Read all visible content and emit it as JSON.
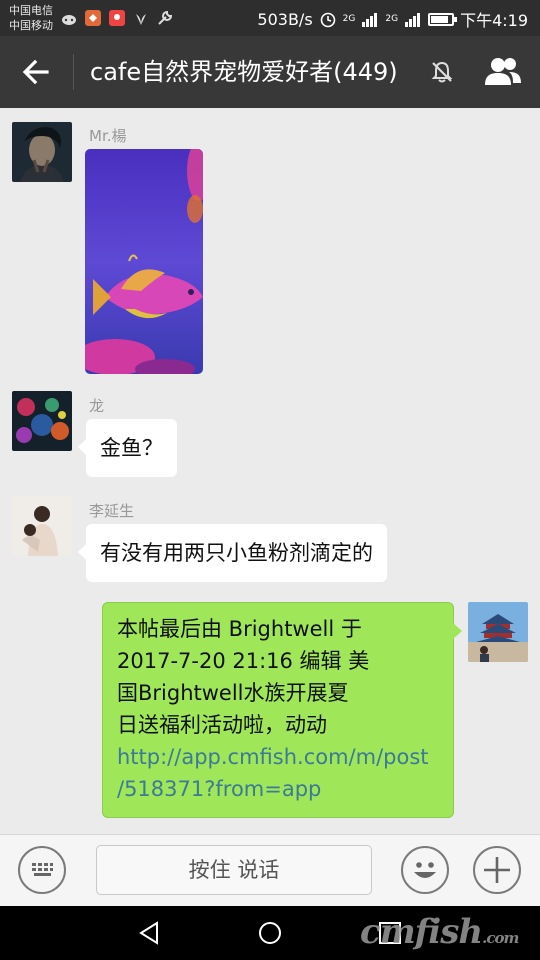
{
  "status_bar": {
    "carrier1": "中国电信",
    "carrier2": "中国移动",
    "speed": "503B/s",
    "network1": "2G",
    "network2": "2G",
    "time": "下午4:19",
    "battery_level": 0.75
  },
  "header": {
    "title": "cafe自然界宠物爱好者(449)"
  },
  "messages": [
    {
      "sender": "Mr.楊",
      "type": "image"
    },
    {
      "sender": "龙",
      "text": "金鱼？"
    },
    {
      "sender": "李延生",
      "text": "有没有用两只小鱼粉剂滴定的"
    },
    {
      "self": true,
      "line1": "本帖最后由 Brightwell 于",
      "line2": "2017-7-20 21:16 编辑 美",
      "line3": "国Brightwell水族开展夏",
      "line4": "日送福利活动啦，动动",
      "link_line1": "http://app.cmfish.com/m/post",
      "link_line2": "/518371?from=app"
    }
  ],
  "input_bar": {
    "voice_label": "按住 说话"
  },
  "watermark": {
    "main": "cmfish",
    "suffix": ".com"
  },
  "colors": {
    "header_bg": "#383838",
    "chat_bg": "#ebebeb",
    "self_bubble": "#9fe658",
    "link": "#3b7a98"
  }
}
